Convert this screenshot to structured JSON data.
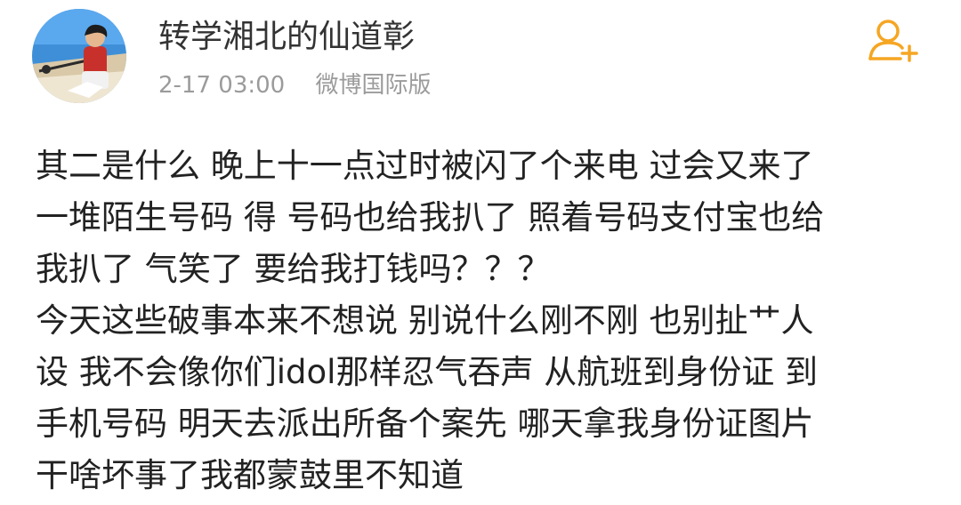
{
  "post": {
    "author": {
      "name": "转学湘北的仙道彰",
      "avatar_icon": "anime-character-avatar-icon"
    },
    "meta": {
      "time": "2-17 03:00",
      "source": "微博国际版"
    },
    "follow_icon": "add-user-icon",
    "accent_color": "#f5a623",
    "content_lines": [
      "其二是什么 晚上十一点过时被闪了个来电 过会又来了",
      "一堆陌生号码 得 号码也给我扒了 照着号码支付宝也给",
      "我扒了 气笑了 要给我打钱吗？？？",
      "今天这些破事本来不想说 别说什么刚不刚 也别扯艹人",
      "设 我不会像你们idol那样忍气吞声 从航班到身份证 到",
      "手机号码 明天去派出所备个案先 哪天拿我身份证图片",
      "干啥坏事了我都蒙鼓里不知道"
    ]
  }
}
